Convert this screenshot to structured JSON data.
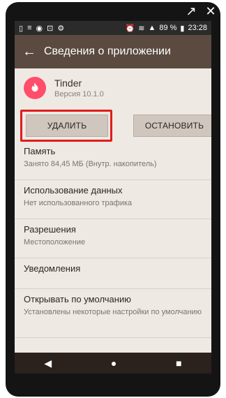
{
  "status": {
    "battery": "89 %",
    "time": "23:28"
  },
  "appbar": {
    "title": "Сведения о приложении"
  },
  "app": {
    "name": "Tinder",
    "version": "Версия 10.1.0"
  },
  "buttons": {
    "delete": "УДАЛИТЬ",
    "stop": "ОСТАНОВИТЬ"
  },
  "items": [
    {
      "title": "Память",
      "subtitle": "Занято 84,45 МБ (Внутр. накопитель)"
    },
    {
      "title": "Использование данных",
      "subtitle": "Нет использованного трафика"
    },
    {
      "title": "Разрешения",
      "subtitle": "Местоположение"
    },
    {
      "title": "Уведомления",
      "subtitle": ""
    },
    {
      "title": "Открывать по умолчанию",
      "subtitle": "Установлены некоторые настройки по умолчанию"
    }
  ],
  "colors": {
    "accent_highlight": "#e01d1d",
    "appbar": "#5a4a40",
    "background": "#efe9e3"
  },
  "icons": {
    "top_right": [
      "external-link-icon",
      "close-icon"
    ],
    "status_left": [
      "sim-icon",
      "vibration-icon",
      "eye-icon",
      "screen-record-icon",
      "settings-icon"
    ],
    "status_right": [
      "alarm-icon",
      "wifi-icon",
      "signal-icon",
      "battery-icon"
    ],
    "nav": [
      "back-nav-icon",
      "home-nav-icon",
      "recent-apps-icon"
    ]
  }
}
